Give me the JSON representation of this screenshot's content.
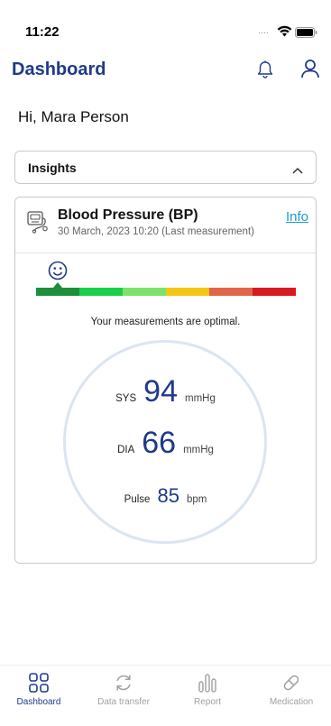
{
  "status_bar": {
    "time": "11:22",
    "signal": "....",
    "wifi_icon": "wifi-icon",
    "battery_icon": "battery-icon"
  },
  "header": {
    "title": "Dashboard",
    "bell_icon": "bell-icon",
    "user_icon": "user-icon"
  },
  "greeting": "Hi, Mara Person",
  "insights": {
    "label": "Insights",
    "chevron_icon": "chevron-up-icon"
  },
  "bp_card": {
    "icon": "blood-pressure-monitor-icon",
    "title": "Blood Pressure (BP)",
    "subtitle": "30 March, 2023 10:20 (Last measurement)",
    "info_link": "Info",
    "smiley_icon": "smiley-icon",
    "scale_colors": [
      "#1d8f3c",
      "#19cf4a",
      "#7de26a",
      "#f5c714",
      "#e2654a",
      "#d61a1f"
    ],
    "status": "Your measurements are optimal.",
    "sys": {
      "label": "SYS",
      "value": "94",
      "unit": "mmHg"
    },
    "dia": {
      "label": "DIA",
      "value": "66",
      "unit": "mmHg"
    },
    "pulse": {
      "label": "Pulse",
      "value": "85",
      "unit": "bpm"
    }
  },
  "tabbar": {
    "tabs": [
      {
        "label": "Dashboard",
        "icon": "grid-icon",
        "active": true
      },
      {
        "label": "Data transfer",
        "icon": "sync-icon",
        "active": false
      },
      {
        "label": "Report",
        "icon": "bar-chart-icon",
        "active": false
      },
      {
        "label": "Medication",
        "icon": "pill-icon",
        "active": false
      }
    ]
  },
  "colors": {
    "primary": "#1e3a8a",
    "link": "#1a9ad6",
    "inactive": "#a0a0a0"
  }
}
